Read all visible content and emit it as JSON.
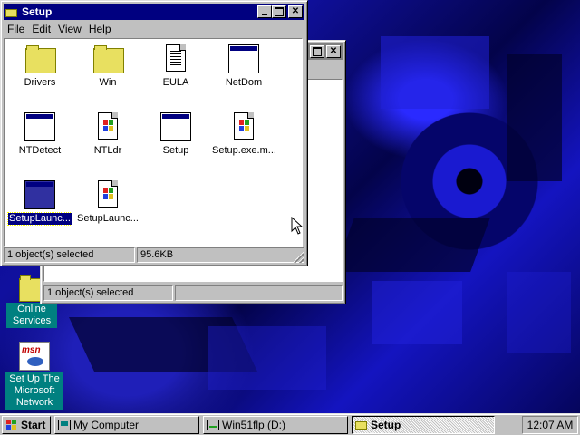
{
  "desktop": {
    "icons": [
      {
        "label": "Online Services",
        "icon": "folder-icon"
      },
      {
        "label": "Set Up The Microsoft Network",
        "icon": "msn-icon"
      }
    ]
  },
  "back_window": {
    "status": "1 object(s) selected"
  },
  "setup_window": {
    "title": "Setup",
    "menu": [
      "File",
      "Edit",
      "View",
      "Help"
    ],
    "items": [
      {
        "label": "Drivers",
        "icon": "folder-icon"
      },
      {
        "label": "Win",
        "icon": "folder-icon"
      },
      {
        "label": "EULA",
        "icon": "document-icon"
      },
      {
        "label": "NetDom",
        "icon": "application-icon"
      },
      {
        "label": "NTDetect",
        "icon": "application-icon"
      },
      {
        "label": "NTLdr",
        "icon": "windows-file-icon"
      },
      {
        "label": "Setup",
        "icon": "application-icon"
      },
      {
        "label": "Setup.exe.m...",
        "icon": "windows-file-icon"
      },
      {
        "label": "SetupLaunc...",
        "icon": "application-icon",
        "selected": true
      },
      {
        "label": "SetupLaunc...",
        "icon": "windows-file-icon"
      }
    ],
    "status_count": "1 object(s) selected",
    "status_size": "95.6KB"
  },
  "taskbar": {
    "start_label": "Start",
    "buttons": [
      {
        "label": "My Computer"
      },
      {
        "label": "Win51flp (D:)"
      },
      {
        "label": "Setup"
      }
    ],
    "clock": "12:07 AM"
  },
  "colors": {
    "titlebar_active": "#000080",
    "titlebar_inactive": "#808080",
    "window_face": "#c0c0c0",
    "desktop_label_bg": "#008080"
  }
}
